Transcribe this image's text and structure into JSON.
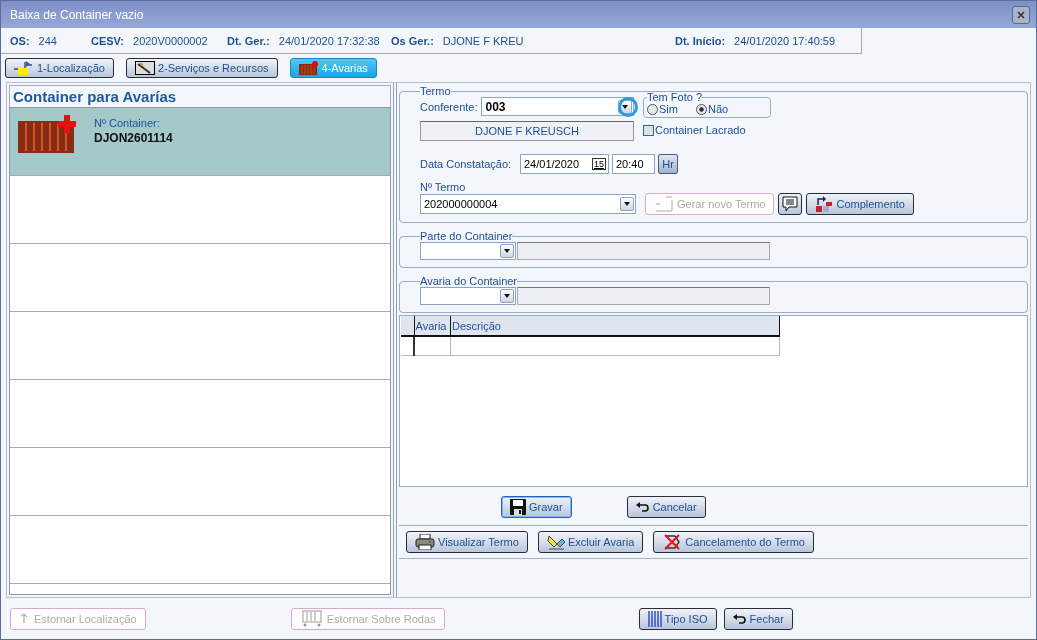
{
  "window": {
    "title": "Baixa de Container vazio"
  },
  "header_fields": [
    {
      "label": "OS:",
      "value": "244"
    },
    {
      "label": "CESV:",
      "value": "2020V0000002"
    },
    {
      "label": "Dt. Ger.:",
      "value": "24/01/2020 17:32:38"
    },
    {
      "label": "Os Ger.:",
      "value": "DJONE F KREU"
    },
    {
      "label": "Dt. Início:",
      "value": "24/01/2020 17:40:59"
    }
  ],
  "tabs": [
    {
      "label": "1-Localização",
      "kind": "location",
      "selected": false
    },
    {
      "label": "2-Serviços e Recursos",
      "kind": "tools",
      "selected": false
    },
    {
      "label": "4-Avarias",
      "kind": "container",
      "selected": true
    }
  ],
  "container_list": {
    "title": "Container para Avarías",
    "items": [
      {
        "label": "Nº Container:",
        "number": "DJON2601114",
        "selected": true
      }
    ]
  },
  "termo": {
    "title": "Termo",
    "conferente": {
      "label": "Conferente:",
      "value": "003",
      "name": "DJONE F KREUSCH"
    },
    "tem_foto": {
      "title": "Tem Foto ?",
      "options": [
        {
          "label": "Sim",
          "selected": false
        },
        {
          "label": "Não",
          "selected": true
        }
      ]
    },
    "container_lacrado": {
      "label": "Container Lacrado",
      "checked": false
    },
    "data_constatacao": {
      "label": "Data Constatação:",
      "date": "24/01/2020",
      "calendar": "15",
      "time": "20:40",
      "hour_button": "Hr"
    },
    "numero_termo": {
      "label": "Nº Termo",
      "value": "202000000004"
    },
    "buttons": [
      {
        "label": "Gerar novo Termo",
        "kind": "new",
        "disabled": true
      },
      {
        "kind": "comment",
        "disabled": false
      },
      {
        "label": "Complemento",
        "kind": "complement",
        "disabled": false
      }
    ]
  },
  "parte_container": {
    "title": "Parte do Container"
  },
  "avaria_container": {
    "title": "Avaria do Container"
  },
  "grid": {
    "columns": [
      "Avaria",
      "Descrição"
    ]
  },
  "form_buttons": [
    {
      "label": "Gravar",
      "kind": "save",
      "focused": true
    },
    {
      "label": "Cancelar",
      "kind": "undo",
      "focused": false
    }
  ],
  "term_buttons": [
    {
      "label": "Visualizar Termo",
      "kind": "printer"
    },
    {
      "label": "Excluir Avaria",
      "kind": "erase"
    },
    {
      "label": "Cancelamento do Termo",
      "kind": "cancel"
    }
  ],
  "footer_buttons": [
    {
      "label": "Estornar Localização",
      "kind": "pick",
      "disabled": true
    },
    {
      "label": "Estornar Sobre Rodas",
      "kind": "wheels",
      "disabled": true
    },
    {
      "label": "Tipo ISO",
      "kind": "iso",
      "disabled": false
    },
    {
      "label": "Fechar",
      "kind": "undo",
      "disabled": false
    }
  ]
}
